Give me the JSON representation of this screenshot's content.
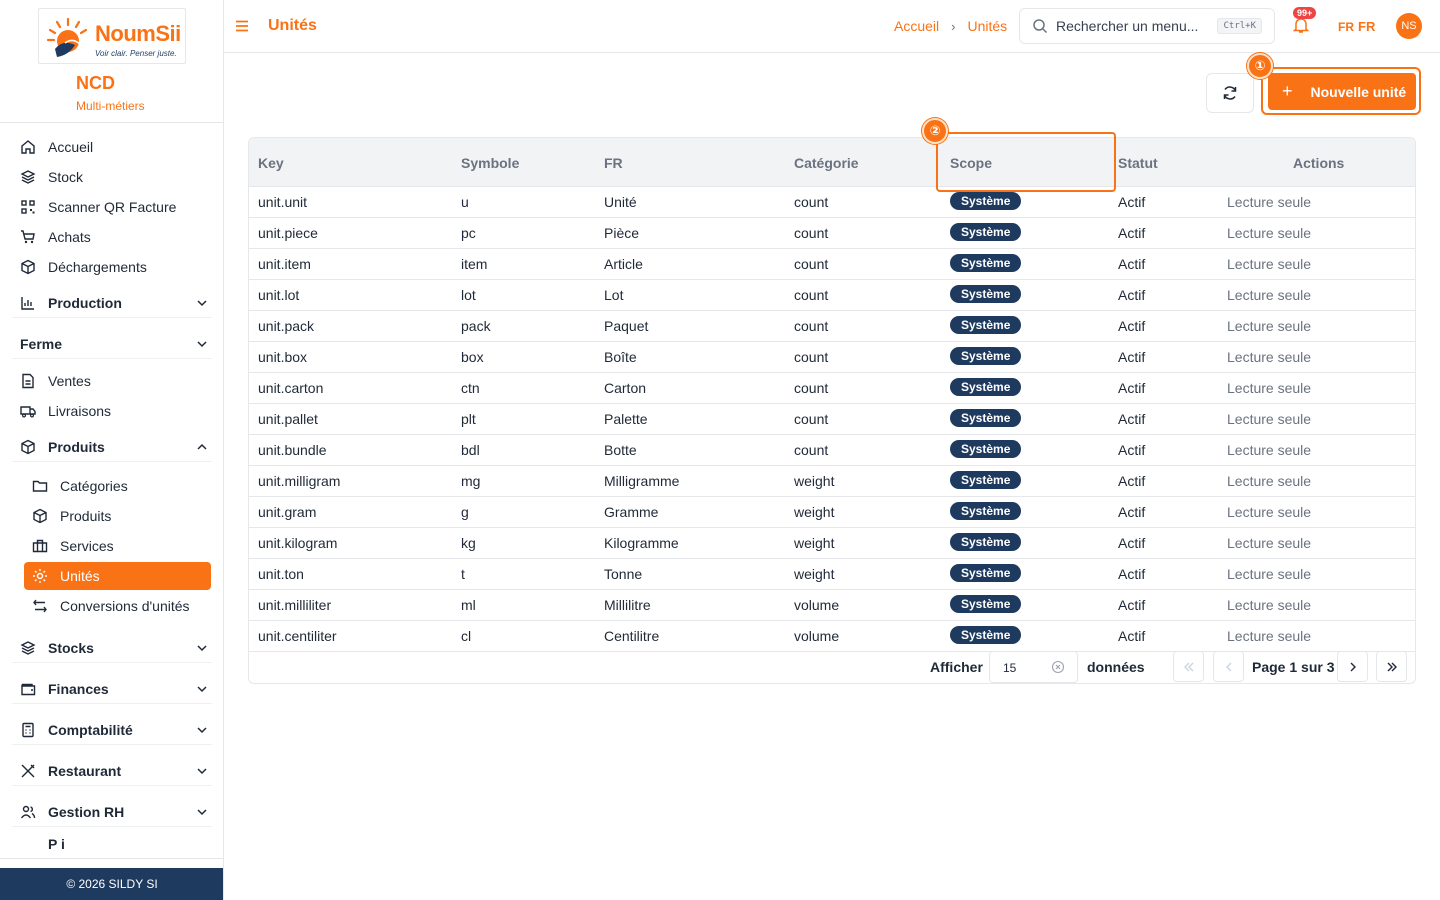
{
  "brand": {
    "name": "NoumSii",
    "tagline": "Voir clair. Penser juste."
  },
  "org": {
    "name": "NCD",
    "subtitle": "Multi-métiers"
  },
  "sidebar": {
    "items": [
      {
        "label": "Accueil",
        "icon": "home-icon"
      },
      {
        "label": "Stock",
        "icon": "layers-icon"
      },
      {
        "label": "Scanner QR Facture",
        "icon": "qr-icon"
      },
      {
        "label": "Achats",
        "icon": "cart-icon"
      },
      {
        "label": "Déchargements",
        "icon": "box-icon"
      }
    ],
    "groups": {
      "production": "Production",
      "ferme": "Ferme",
      "produits": "Produits",
      "stocks": "Stocks",
      "finances": "Finances",
      "comptabilite": "Comptabilité",
      "restaurant": "Restaurant",
      "rh": "Gestion RH",
      "partial": "P i"
    },
    "ferme_items": [
      {
        "label": "Ventes",
        "icon": "file-icon"
      },
      {
        "label": "Livraisons",
        "icon": "truck-icon"
      }
    ],
    "produits_items": [
      {
        "label": "Catégories",
        "icon": "folder-icon"
      },
      {
        "label": "Produits",
        "icon": "box-icon"
      },
      {
        "label": "Services",
        "icon": "briefcase-icon"
      },
      {
        "label": "Unités",
        "icon": "gear-icon",
        "active": true
      },
      {
        "label": "Conversions d'unités",
        "icon": "arrows-icon"
      }
    ],
    "footer": "© 2026 SILDY SI"
  },
  "topbar": {
    "title": "Unités",
    "breadcrumb": [
      "Accueil",
      "Unités"
    ],
    "search_placeholder": "Rechercher un menu...",
    "shortcut": "Ctrl+K",
    "notifications": "99+",
    "lang_small": "FR",
    "lang": "FR",
    "avatar": "NS"
  },
  "toolbar": {
    "new_label": "Nouvelle unité",
    "new_plus": "+"
  },
  "markers": {
    "one": "①",
    "two": "②"
  },
  "table": {
    "columns": [
      "Key",
      "Symbole",
      "FR",
      "Catégorie",
      "Scope",
      "Statut",
      "Actions"
    ],
    "rows": [
      [
        "unit.unit",
        "u",
        "Unité",
        "count",
        "Système",
        "Actif",
        "Lecture seule"
      ],
      [
        "unit.piece",
        "pc",
        "Pièce",
        "count",
        "Système",
        "Actif",
        "Lecture seule"
      ],
      [
        "unit.item",
        "item",
        "Article",
        "count",
        "Système",
        "Actif",
        "Lecture seule"
      ],
      [
        "unit.lot",
        "lot",
        "Lot",
        "count",
        "Système",
        "Actif",
        "Lecture seule"
      ],
      [
        "unit.pack",
        "pack",
        "Paquet",
        "count",
        "Système",
        "Actif",
        "Lecture seule"
      ],
      [
        "unit.box",
        "box",
        "Boîte",
        "count",
        "Système",
        "Actif",
        "Lecture seule"
      ],
      [
        "unit.carton",
        "ctn",
        "Carton",
        "count",
        "Système",
        "Actif",
        "Lecture seule"
      ],
      [
        "unit.pallet",
        "plt",
        "Palette",
        "count",
        "Système",
        "Actif",
        "Lecture seule"
      ],
      [
        "unit.bundle",
        "bdl",
        "Botte",
        "count",
        "Système",
        "Actif",
        "Lecture seule"
      ],
      [
        "unit.milligram",
        "mg",
        "Milligramme",
        "weight",
        "Système",
        "Actif",
        "Lecture seule"
      ],
      [
        "unit.gram",
        "g",
        "Gramme",
        "weight",
        "Système",
        "Actif",
        "Lecture seule"
      ],
      [
        "unit.kilogram",
        "kg",
        "Kilogramme",
        "weight",
        "Système",
        "Actif",
        "Lecture seule"
      ],
      [
        "unit.ton",
        "t",
        "Tonne",
        "weight",
        "Système",
        "Actif",
        "Lecture seule"
      ],
      [
        "unit.milliliter",
        "ml",
        "Millilitre",
        "volume",
        "Système",
        "Actif",
        "Lecture seule"
      ],
      [
        "unit.centiliter",
        "cl",
        "Centilitre",
        "volume",
        "Système",
        "Actif",
        "Lecture seule"
      ]
    ]
  },
  "pagination": {
    "show_label": "Afficher",
    "page_size": "15",
    "unit_label": "données",
    "page_info": "Page 1 sur 3"
  },
  "colors": {
    "accent": "#f97316",
    "navy": "#1e3a5f"
  }
}
